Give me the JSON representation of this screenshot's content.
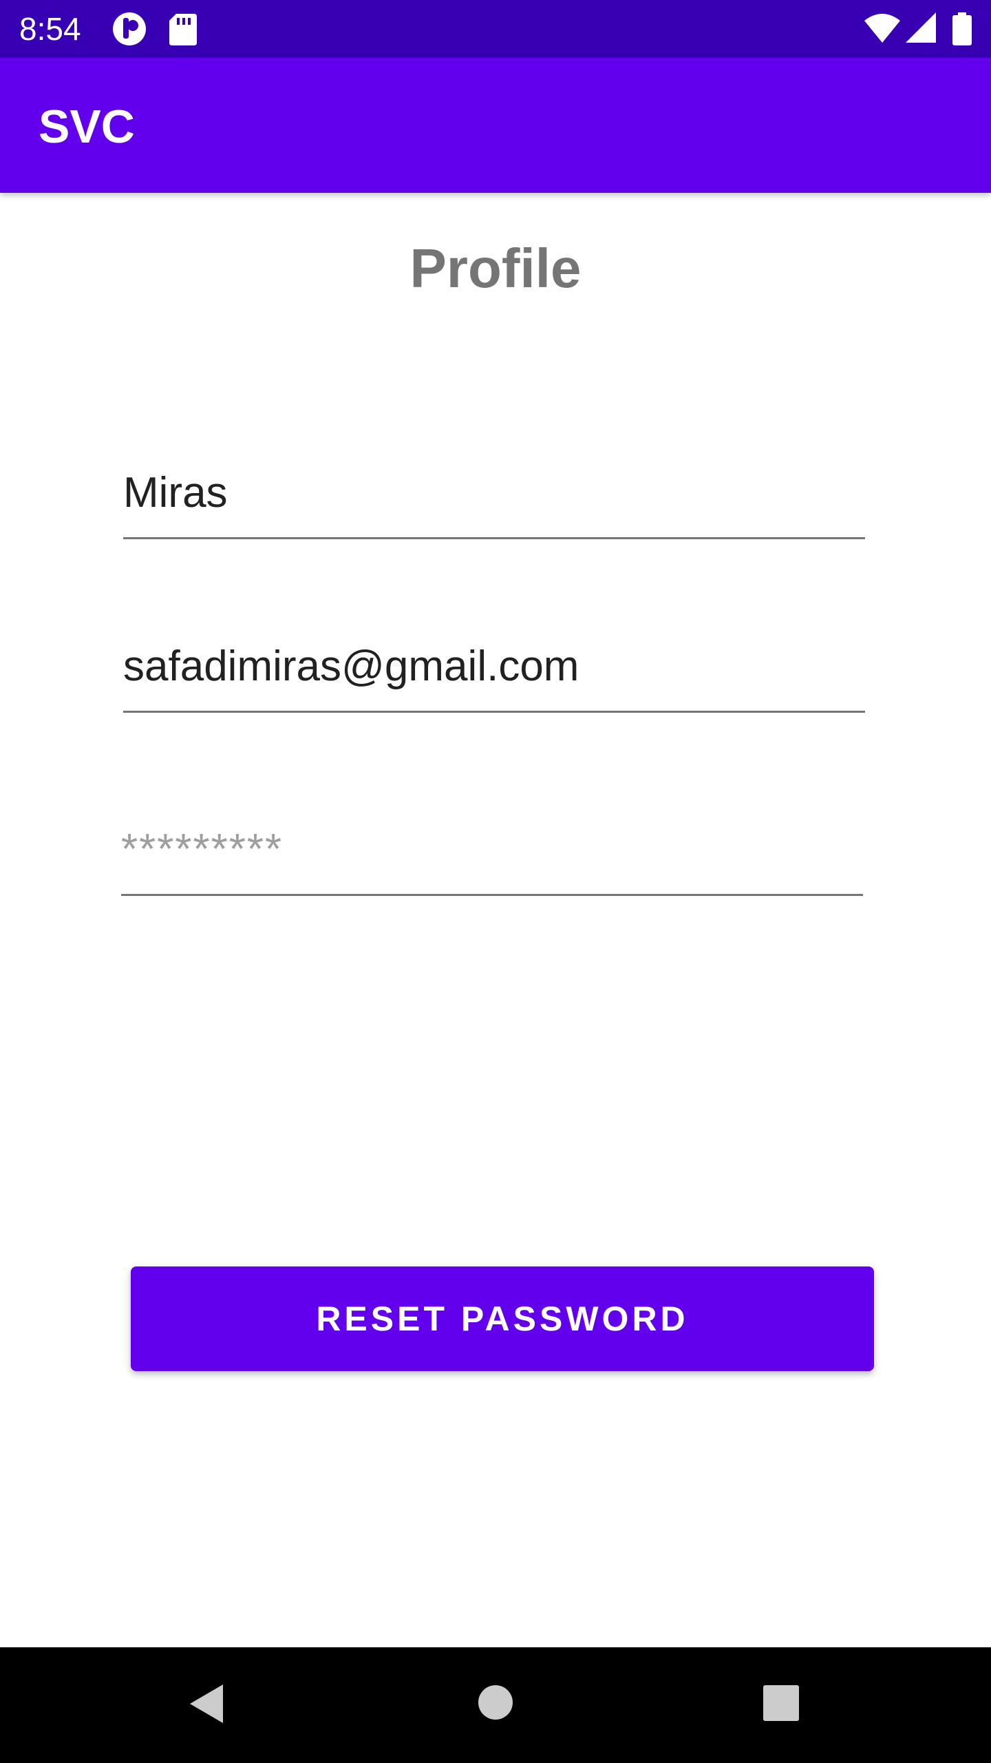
{
  "status_bar": {
    "time": "8:54",
    "icons": [
      "notification-app-icon",
      "sd-card-icon",
      "wifi-icon",
      "cell-signal-icon",
      "battery-icon"
    ]
  },
  "app_bar": {
    "title": "SVC"
  },
  "page": {
    "title": "Profile"
  },
  "form": {
    "name_value": "Miras",
    "email_value": "safadimiras@gmail.com",
    "password_placeholder": "*********"
  },
  "actions": {
    "reset_password_label": "RESET PASSWORD"
  },
  "nav_bar": {
    "icons": [
      "back-icon",
      "home-icon",
      "recents-icon"
    ]
  },
  "colors": {
    "status_bar": "#3700b3",
    "primary": "#6200ee",
    "title_gray": "#757575",
    "text": "#212121",
    "placeholder": "#9e9e9e"
  }
}
